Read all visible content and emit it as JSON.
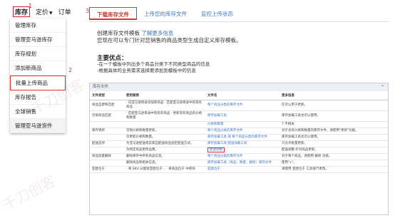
{
  "nav": {
    "tabs": [
      "库存",
      "定价",
      "订单"
    ],
    "steps": [
      "1",
      "2",
      "3"
    ]
  },
  "menu": {
    "items": [
      "管理库存",
      "管理亚马逊库存",
      "库存规划",
      "添加新商品",
      "批量上传商品",
      "库存报告",
      "全球销售",
      "管理亚马逊货件"
    ]
  },
  "tabs": [
    "下载库存文件",
    "上传您的库存文件",
    "监控上传状态"
  ],
  "intro": {
    "line1a": "创建库存文件模板",
    "line1b": "了解更多信息",
    "line2": "您现在可以专门针对您销售的商品类型生成自定义库存模板。"
  },
  "advantages": {
    "title": "主要优点：",
    "items": [
      "-在一个模板中列出多个商品分类下不同类型商品的信息",
      "-根据具体的业务需求选择要添加到模板中的信息"
    ]
  },
  "panel": {
    "title": "库存文件",
    "collapse": "^"
  },
  "table": {
    "headers": [
      "文件类型",
      "使用案例",
      "文件名",
      "更多信息"
    ],
    "rows": [
      {
        "cat": "商品自建和匹配",
        "use": "· 向亚马逊目录添加新商品\n· 匹配亚马逊目录中的现有商品",
        "file": "每个商品分类的库存文件",
        "more": "在可以用于更新。"
      },
      {
        "cat": "仅限商品匹配",
        "use": "· 匹配亚马逊目录中现有的商品\n· 更新现有商品的价格和数量",
        "file": "库存加载工具",
        "more": "库存加载工具也可以使用。"
      },
      {
        "cat": "",
        "use": "",
        "file": "价格和数量",
        "more": "7 不相关"
      },
      {
        "cat": "库存更新",
        "use": "仅限价格和数量更新。",
        "file": "每个商品分类的库存文件",
        "more": "对于含有价格和数量的库存文件，请使用\"更新\"功能。"
      },
      {
        "cat": "",
        "use": "仅更新价格和数量。",
        "file": "库存加载工具  或  每个商品分类的库存文件",
        "more": "库存加载工具也可以使用。"
      },
      {
        "cat": "配送选项",
        "use": "为亚马逊配送或卖家自配送商品指定配送方式。",
        "file": "库存加载工具 配送加载工具",
        "more": "只允许批量更新。"
      },
      {
        "cat": "",
        "use": "为特定商品更改运费。",
        "file": "配送调整",
        "more": "配送调整  针对商品更新。"
      },
      {
        "cat": "商品批量删除",
        "use": "删除库存中所有商品信息。",
        "file": "每个商品分类的库存文件",
        "more": "对于每个商品，请使用 删除 功能。"
      },
      {
        "cat": "",
        "use": "删除商品和相关信息。",
        "file": "库存加载工具（商品、数量、删除）库存文件",
        "more": "使用\"x\"。"
      },
      {
        "cat": "亚欧位于",
        "use": "· 将 SKU 分配给亚欧位于...\n· 将商品位于 中移除",
        "file": "亚欧位于",
        "more": "请使用 亚欧位于 工具进行更改。"
      }
    ]
  },
  "watermark": [
    "千刀创客",
    "千刀创客"
  ]
}
